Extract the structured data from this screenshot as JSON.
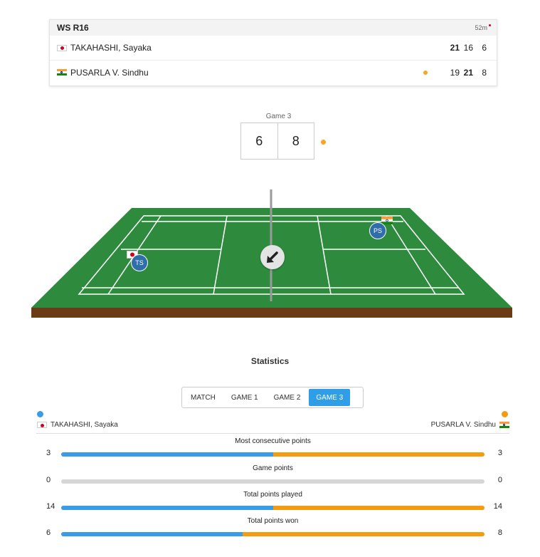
{
  "match": {
    "round": "WS R16",
    "duration": "52m",
    "players": [
      {
        "name": "TAKAHASHI, Sayaka",
        "flag": "japan-flag-icon",
        "serving": false,
        "games": [
          "21",
          "16",
          "6"
        ],
        "won": [
          true,
          false,
          false
        ]
      },
      {
        "name": "PUSARLA V. Sindhu",
        "flag": "india-flag-icon",
        "serving": true,
        "games": [
          "19",
          "21",
          "8"
        ],
        "won": [
          false,
          true,
          false
        ]
      }
    ]
  },
  "current_game": {
    "label": "Game 3",
    "score_left": "6",
    "score_right": "8"
  },
  "court": {
    "left_player_initials": "TS",
    "right_player_initials": "PS",
    "shuttle_icon": "arrow-down-left-icon"
  },
  "statistics": {
    "title": "Statistics",
    "tabs": [
      "MATCH",
      "GAME 1",
      "GAME 2",
      "GAME 3"
    ],
    "active_tab": "GAME 3",
    "left_player": "TAKAHASHI, Sayaka",
    "right_player": "PUSARLA V. Sindhu",
    "rows": [
      {
        "label": "Most consecutive points",
        "left": "3",
        "right": "3"
      },
      {
        "label": "Game points",
        "left": "0",
        "right": "0"
      },
      {
        "label": "Total points played",
        "left": "14",
        "right": "14"
      },
      {
        "label": "Total points won",
        "left": "6",
        "right": "8"
      }
    ]
  },
  "colors": {
    "left_player": "#3a9be6",
    "right_player": "#f39c12",
    "court_green": "#2e8b3e",
    "court_base": "#6b3a17",
    "active_tab": "#2f9ee6"
  }
}
